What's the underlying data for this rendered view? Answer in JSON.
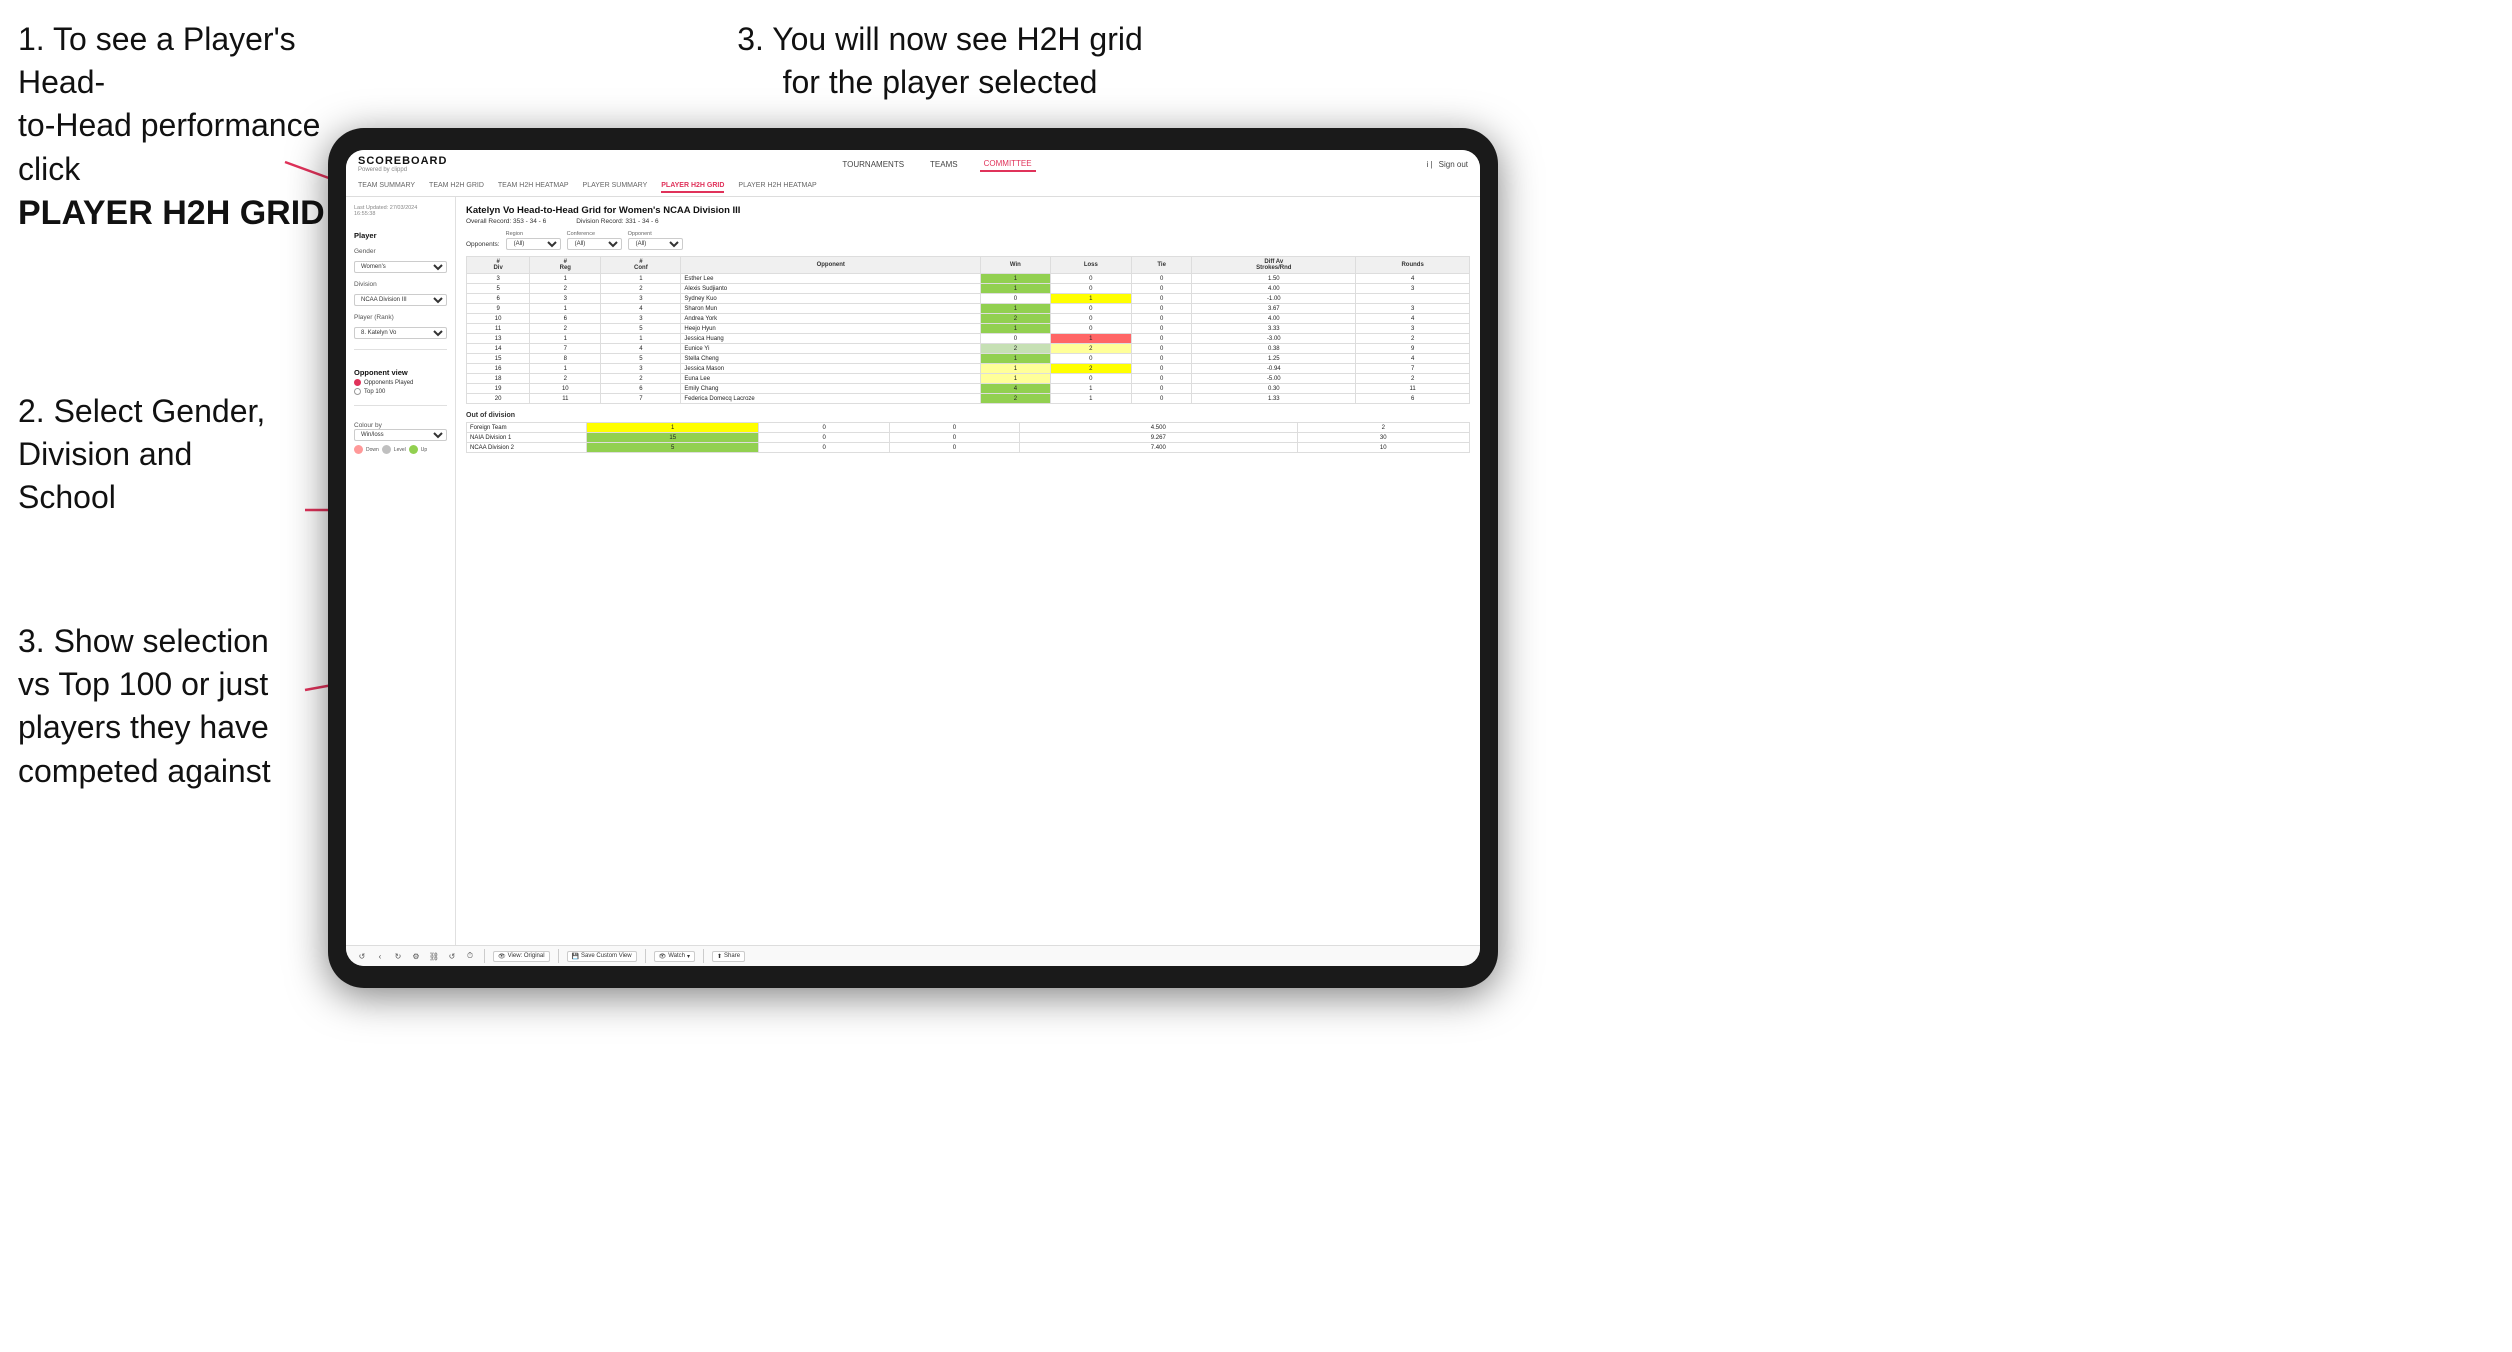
{
  "instructions": {
    "top_left_line1": "1. To see a Player's Head-",
    "top_left_line2": "to-Head performance click",
    "top_left_bold": "PLAYER H2H GRID",
    "top_right": "3. You will now see H2H grid\nfor the player selected",
    "mid_left_line1": "2. Select Gender,",
    "mid_left_line2": "Division and",
    "mid_left_line3": "School",
    "bottom_left_line1": "3. Show selection",
    "bottom_left_line2": "vs Top 100 or just",
    "bottom_left_line3": "players they have",
    "bottom_left_line4": "competed against"
  },
  "nav": {
    "logo": "SCOREBOARD",
    "logo_sub": "Powered by clippd",
    "links": [
      "TOURNAMENTS",
      "TEAMS",
      "COMMITTEE"
    ],
    "active_link": "COMMITTEE",
    "sign_in": "Sign out",
    "sub_links": [
      "TEAM SUMMARY",
      "TEAM H2H GRID",
      "TEAM H2H HEATMAP",
      "PLAYER SUMMARY",
      "PLAYER H2H GRID",
      "PLAYER H2H HEATMAP"
    ],
    "active_sub": "PLAYER H2H GRID"
  },
  "sidebar": {
    "timestamp": "Last Updated: 27/03/2024\n16:55:38",
    "player_label": "Player",
    "gender_label": "Gender",
    "gender_value": "Women's",
    "division_label": "Division",
    "division_value": "NCAA Division III",
    "player_rank_label": "Player (Rank)",
    "player_rank_value": "8. Katelyn Vo",
    "opponent_view_label": "Opponent view",
    "radio_options": [
      "Opponents Played",
      "Top 100"
    ],
    "selected_radio": "Opponents Played",
    "colour_by_label": "Colour by",
    "colour_by_value": "Win/loss",
    "legend": [
      {
        "label": "Down",
        "color": "#ff9999"
      },
      {
        "label": "Level",
        "color": "#c0c0c0"
      },
      {
        "label": "Up",
        "color": "#92d050"
      }
    ]
  },
  "grid": {
    "title": "Katelyn Vo Head-to-Head Grid for Women's NCAA Division III",
    "overall_record": "Overall Record: 353 - 34 - 6",
    "division_record": "Division Record: 331 - 34 - 6",
    "region_label": "Region",
    "conference_label": "Conference",
    "opponent_label": "Opponent",
    "opponents_label": "Opponents:",
    "region_filter": "(All)",
    "conference_filter": "(All)",
    "opponent_filter": "(All)",
    "columns": [
      "# Div",
      "# Reg",
      "# Conf",
      "Opponent",
      "Win",
      "Loss",
      "Tie",
      "Diff Av Strokes/Rnd",
      "Rounds"
    ],
    "rows": [
      {
        "div": 3,
        "reg": 1,
        "conf": 1,
        "opponent": "Esther Lee",
        "win": 1,
        "loss": 0,
        "tie": 0,
        "diff": 1.5,
        "rounds": 4,
        "win_color": "green",
        "loss_color": "white"
      },
      {
        "div": 5,
        "reg": 2,
        "conf": 2,
        "opponent": "Alexis Sudjianto",
        "win": 1,
        "loss": 0,
        "tie": 0,
        "diff": 4.0,
        "rounds": 3,
        "win_color": "green"
      },
      {
        "div": 6,
        "reg": 3,
        "conf": 3,
        "opponent": "Sydney Kuo",
        "win": 0,
        "loss": 1,
        "tie": 0,
        "diff": -1.0,
        "rounds": "",
        "win_color": "white",
        "loss_color": "yellow"
      },
      {
        "div": 9,
        "reg": 1,
        "conf": 4,
        "opponent": "Sharon Mun",
        "win": 1,
        "loss": 0,
        "tie": 0,
        "diff": 3.67,
        "rounds": 3,
        "win_color": "green"
      },
      {
        "div": 10,
        "reg": 6,
        "conf": 3,
        "opponent": "Andrea York",
        "win": 2,
        "loss": 0,
        "tie": 0,
        "diff": 4.0,
        "rounds": 4,
        "win_color": "green"
      },
      {
        "div": 11,
        "reg": 2,
        "conf": 5,
        "opponent": "Heejo Hyun",
        "win": 1,
        "loss": 0,
        "tie": 0,
        "diff": 3.33,
        "rounds": 3,
        "win_color": "green"
      },
      {
        "div": 13,
        "reg": 1,
        "conf": 1,
        "opponent": "Jessica Huang",
        "win": 0,
        "loss": 1,
        "tie": 0,
        "diff": -3.0,
        "rounds": 2,
        "win_color": "white",
        "loss_color": "red"
      },
      {
        "div": 14,
        "reg": 7,
        "conf": 4,
        "opponent": "Eunice Yi",
        "win": 2,
        "loss": 2,
        "tie": 0,
        "diff": 0.38,
        "rounds": "",
        "rounds2": 9
      },
      {
        "div": 15,
        "reg": 8,
        "conf": 5,
        "opponent": "Stella Cheng",
        "win": 1,
        "loss": 0,
        "tie": 0,
        "diff": 1.25,
        "rounds": 4,
        "win_color": "green"
      },
      {
        "div": 16,
        "reg": 1,
        "conf": 3,
        "opponent": "Jessica Mason",
        "win": 1,
        "loss": 2,
        "tie": 0,
        "diff": -0.94,
        "rounds": 7,
        "win_color": "light-yellow",
        "loss_color": "yellow"
      },
      {
        "div": 18,
        "reg": 2,
        "conf": 2,
        "opponent": "Euna Lee",
        "win": 1,
        "loss": 0,
        "tie": 0,
        "diff": -5.0,
        "rounds": 2,
        "win_color": "light-yellow"
      },
      {
        "div": 19,
        "reg": 10,
        "conf": 6,
        "opponent": "Emily Chang",
        "win": 4,
        "loss": 1,
        "tie": 0,
        "diff": 0.3,
        "rounds": "",
        "rounds2": 11,
        "win_color": "green"
      },
      {
        "div": 20,
        "reg": 11,
        "conf": 7,
        "opponent": "Federica Domecq Lacroze",
        "win": 2,
        "loss": 1,
        "tie": 0,
        "diff": 1.33,
        "rounds": 6,
        "win_color": "green"
      }
    ],
    "out_of_division_title": "Out of division",
    "out_of_division_rows": [
      {
        "label": "Foreign Team",
        "win": 1,
        "loss": 0,
        "tie": 0,
        "diff": 4.5,
        "rounds": 2,
        "color": "yellow"
      },
      {
        "label": "NAIA Division 1",
        "win": 15,
        "loss": 0,
        "tie": 0,
        "diff": 9.267,
        "rounds": "",
        "rounds2": 30,
        "color": "green"
      },
      {
        "label": "NCAA Division 2",
        "win": 5,
        "loss": 0,
        "tie": 0,
        "diff": 7.4,
        "rounds": 10,
        "color": "green"
      }
    ]
  },
  "toolbar": {
    "buttons": [
      "View: Original",
      "Save Custom View",
      "Watch",
      "Share"
    ],
    "icons": [
      "undo",
      "redo",
      "settings",
      "refresh",
      "clock"
    ]
  }
}
